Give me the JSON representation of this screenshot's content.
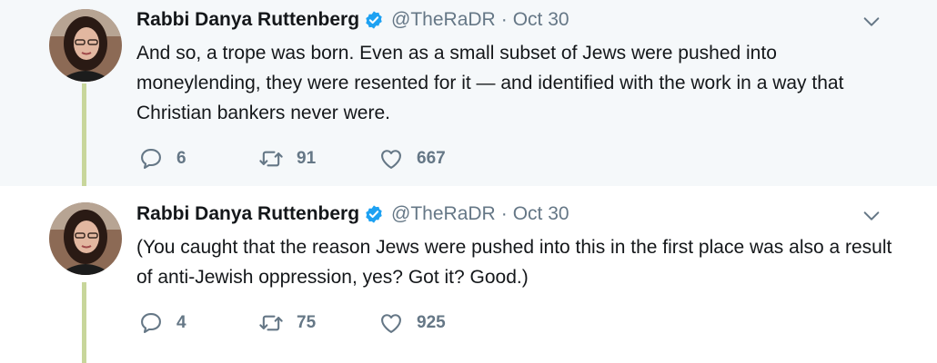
{
  "tweets": [
    {
      "author_name": "Rabbi Danya Ruttenberg",
      "handle": "@TheRaDR",
      "separator": "·",
      "date": "Oct 30",
      "text": "And so, a trope was born.  Even as a small subset of Jews were pushed into moneylending, they were resented for it — and identified with the work in a way that Christian bankers never were.",
      "replies": "6",
      "retweets": "91",
      "likes": "667"
    },
    {
      "author_name": "Rabbi Danya Ruttenberg",
      "handle": "@TheRaDR",
      "separator": "·",
      "date": "Oct 30",
      "text": "(You caught that the reason Jews were pushed into this in the first place was also a result of anti-Jewish oppression, yes? Got it? Good.)",
      "replies": "4",
      "retweets": "75",
      "likes": "925"
    }
  ],
  "colors": {
    "highlight_bg": "#f5f8fa",
    "thread_line": "#c8d69b",
    "verified": "#1da1f2",
    "muted": "#657786"
  },
  "icons": [
    "verified-badge-icon",
    "chevron-down-icon",
    "reply-icon",
    "retweet-icon",
    "like-icon"
  ]
}
